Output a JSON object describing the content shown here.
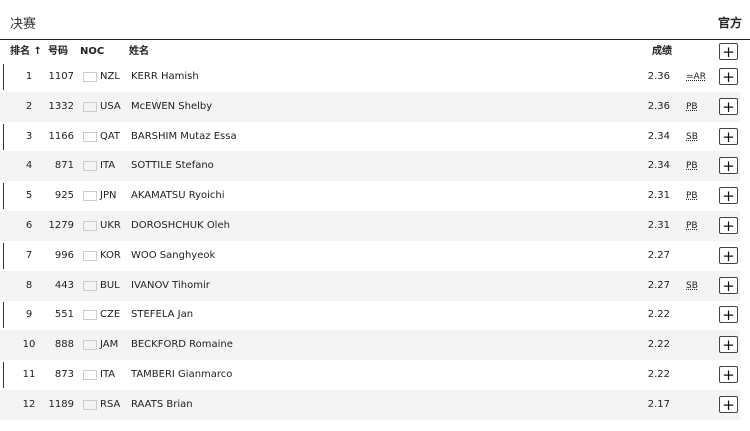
{
  "page": {
    "title": "决赛",
    "official_label": "官方"
  },
  "table": {
    "columns": {
      "rank": "排名 ↑",
      "bib": "号码",
      "noc": "NOC",
      "name": "姓名",
      "result": "成绩",
      "expand": "+"
    },
    "rows": [
      {
        "rank": "1",
        "bib": "1107",
        "noc": "NZL",
        "flag": "nzl",
        "name": "KERR Hamish",
        "result": "2.36",
        "record": "=AR",
        "alt": false,
        "bar": true
      },
      {
        "rank": "2",
        "bib": "1332",
        "noc": "USA",
        "flag": "usa",
        "name": "McEWEN Shelby",
        "result": "2.36",
        "record": "PB",
        "alt": true,
        "bar": false
      },
      {
        "rank": "3",
        "bib": "1166",
        "noc": "QAT",
        "flag": "qat",
        "name": "BARSHIM Mutaz Essa",
        "result": "2.34",
        "record": "SB",
        "alt": false,
        "bar": true
      },
      {
        "rank": "4",
        "bib": "871",
        "noc": "ITA",
        "flag": "ita",
        "name": "SOTTILE Stefano",
        "result": "2.34",
        "record": "PB",
        "alt": true,
        "bar": false
      },
      {
        "rank": "5",
        "bib": "925",
        "noc": "JPN",
        "flag": "jpn",
        "name": "AKAMATSU Ryoichi",
        "result": "2.31",
        "record": "PB",
        "alt": false,
        "bar": true
      },
      {
        "rank": "6",
        "bib": "1279",
        "noc": "UKR",
        "flag": "ukr",
        "name": "DOROSHCHUK Oleh",
        "result": "2.31",
        "record": "PB",
        "alt": true,
        "bar": false
      },
      {
        "rank": "7",
        "bib": "996",
        "noc": "KOR",
        "flag": "kor",
        "name": "WOO Sanghyeok",
        "result": "2.27",
        "record": "",
        "alt": false,
        "bar": true
      },
      {
        "rank": "8",
        "bib": "443",
        "noc": "BUL",
        "flag": "bul",
        "name": "IVANOV Tihomir",
        "result": "2.27",
        "record": "SB",
        "alt": true,
        "bar": false
      },
      {
        "rank": "9",
        "bib": "551",
        "noc": "CZE",
        "flag": "cze",
        "name": "STEFELA Jan",
        "result": "2.22",
        "record": "",
        "alt": false,
        "bar": true
      },
      {
        "rank": "10",
        "bib": "888",
        "noc": "JAM",
        "flag": "jam",
        "name": "BECKFORD Romaine",
        "result": "2.22",
        "record": "",
        "alt": true,
        "bar": false
      },
      {
        "rank": "11",
        "bib": "873",
        "noc": "ITA",
        "flag": "ita",
        "name": "TAMBERI Gianmarco",
        "result": "2.22",
        "record": "",
        "alt": false,
        "bar": true
      },
      {
        "rank": "12",
        "bib": "1189",
        "noc": "RSA",
        "flag": "rsa",
        "name": "RAATS Brian",
        "result": "2.17",
        "record": "",
        "alt": true,
        "bar": false
      }
    ]
  }
}
